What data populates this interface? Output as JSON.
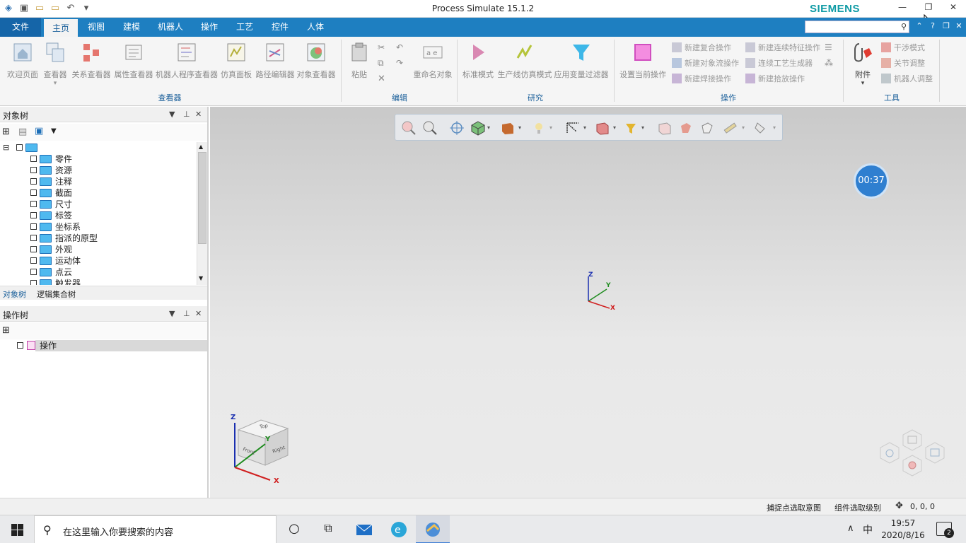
{
  "window": {
    "title": "Process Simulate 15.1.2",
    "brand": "SIEMENS"
  },
  "tabs": [
    {
      "label": "文件"
    },
    {
      "label": "主页"
    },
    {
      "label": "视图"
    },
    {
      "label": "建模"
    },
    {
      "label": "机器人"
    },
    {
      "label": "操作"
    },
    {
      "label": "工艺"
    },
    {
      "label": "控件"
    },
    {
      "label": "人体"
    }
  ],
  "search": {
    "value": "",
    "placeholder": ""
  },
  "ribbon": {
    "viewers": [
      {
        "label": "欢迎页面"
      },
      {
        "label": "查看器"
      },
      {
        "label": "关系查看器"
      },
      {
        "label": "属性查看器"
      },
      {
        "label": "机器人程序查看器"
      },
      {
        "label": "仿真面板"
      },
      {
        "label": "路径编辑器"
      },
      {
        "label": "对象查看器"
      }
    ],
    "edit": {
      "paste": "粘贴",
      "rename": "重命名对象"
    },
    "study": [
      {
        "label": "标准模式"
      },
      {
        "label": "生产线仿真模式"
      },
      {
        "label": "应用变量过滤器"
      }
    ],
    "operations": {
      "set_current": "设置当前操作",
      "col1": [
        "新建复合操作",
        "新建对象流操作",
        "新建焊接操作"
      ],
      "col2": [
        "新建连续特征操作",
        "连续工艺生成器",
        "新建拾放操作"
      ]
    },
    "tools": {
      "attach": "附件",
      "items": [
        "干涉模式",
        "关节调整",
        "机器人调整"
      ]
    },
    "groups": {
      "viewers": "查看器",
      "edit": "编辑",
      "study": "研究",
      "operations": "操作",
      "tools": "工具"
    }
  },
  "object_tree": {
    "title": "对象树",
    "items": [
      "零件",
      "资源",
      "注释",
      "截面",
      "尺寸",
      "标签",
      "坐标系",
      "指派的原型",
      "外观",
      "运动体",
      "点云",
      "触发器"
    ],
    "bottom_tabs": [
      "对象树",
      "逻辑集合树"
    ]
  },
  "operation_tree": {
    "title": "操作树",
    "root": "操作"
  },
  "viewport": {
    "timer": "00:37",
    "axes": {
      "x": "X",
      "y": "Y",
      "z": "Z"
    },
    "cube": {
      "top": "Top",
      "front": "Front",
      "right": "Right"
    }
  },
  "statusbar": {
    "pick_intent": "捕捉点选取意图",
    "pick_level": "组件选取级别",
    "coords": "0, 0, 0"
  },
  "taskbar": {
    "search_placeholder": "在这里输入你要搜索的内容",
    "ime": "中",
    "time": "19:57",
    "date": "2020/8/16",
    "notif_count": "2"
  }
}
